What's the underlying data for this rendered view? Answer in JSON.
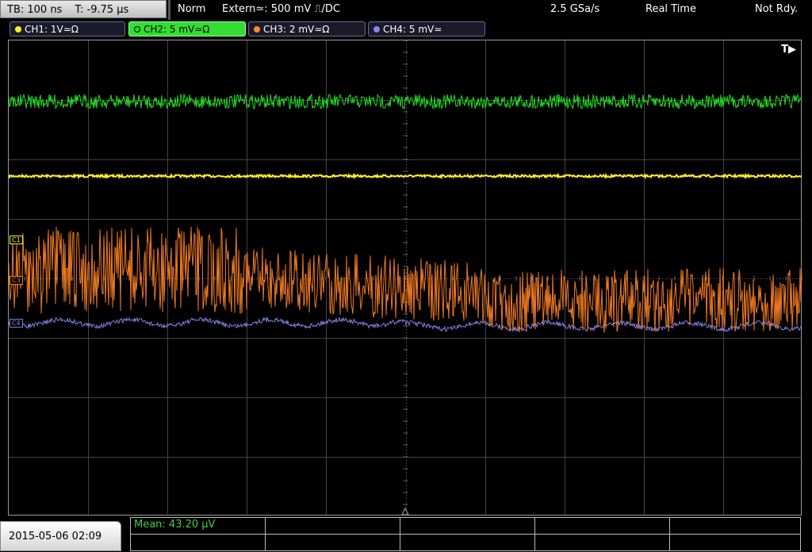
{
  "header": {
    "timebase": "TB: 100 ns",
    "trigger_time": "T: -9.75 µs",
    "trigger_mode": "Norm",
    "trigger_source": "Extern≃: 500 mV ⎍/DC",
    "sample_rate": "2.5 GSa/s",
    "acq_mode": "Real Time",
    "ready_state": "Not Rdy."
  },
  "channels": [
    {
      "label": "CH1: 1V≃Ω",
      "color": "#ffee22"
    },
    {
      "label": "CH2: 5 mV≃Ω",
      "color": "#22dd22",
      "active": true
    },
    {
      "label": "CH3: 2 mV≃Ω",
      "color": "#ff8833"
    },
    {
      "label": "CH4: 5 mV≃",
      "color": "#8888ee"
    }
  ],
  "display": {
    "trigger_marker": "T▶",
    "markers": {
      "c1": "C1",
      "c3": "C3",
      "c4": "C4"
    }
  },
  "footer": {
    "date": "2015-05-06 02:09",
    "measurement": "Mean: 43.20 µV"
  },
  "colors": {
    "ch1": "#ffee22",
    "ch2": "#22dd22",
    "ch3": "#ee7a22",
    "ch4": "#7f7fe0",
    "grid": "#444444"
  }
}
